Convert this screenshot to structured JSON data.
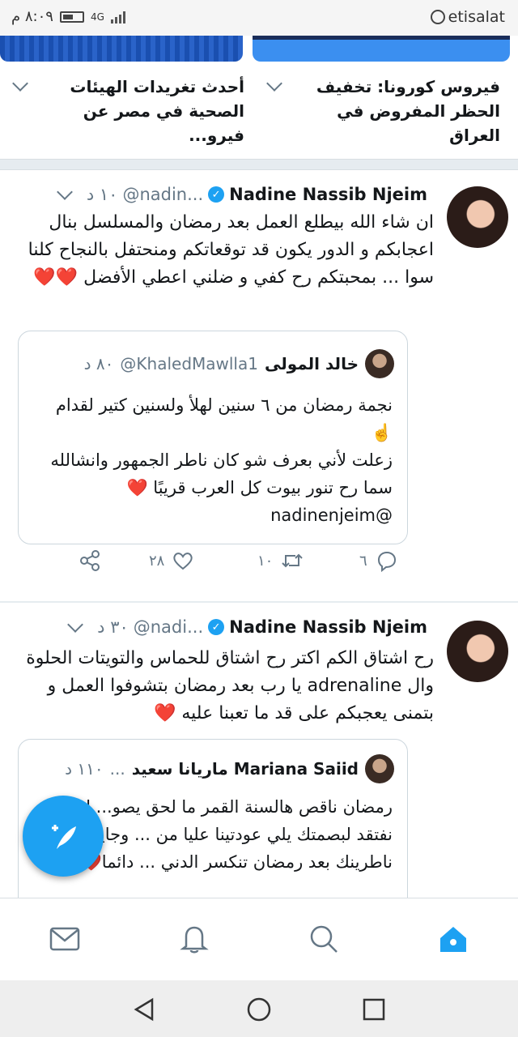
{
  "status_bar": {
    "carrier": "etisalat",
    "time": "٨:٠٩ م",
    "network": "4G"
  },
  "trends": [
    {
      "text": "فيروس كورونا: تخفيف الحظر المفروض في العراق"
    },
    {
      "text": "أحدث تغريدات الهيئات الصحية في مصر عن فيرو..."
    }
  ],
  "tweets": [
    {
      "name": "Nadine Nassib Njeim",
      "handle": "@nadin...",
      "time": "١٠ د",
      "text": "ان شاء الله بيطلع العمل بعد رمضان والمسلسل بنال اعجابكم و الدور يكون قد توقعاتكم ومنحتفل بالنجاح كلنا سوا ... بمحبتكم رح كفي و ضلني اعطي الأفضل ❤️❤️",
      "quote": {
        "name": "خالد المولى",
        "handle": "@KhaledMawlla1",
        "time": "٨٠ د",
        "text": "نجمة رمضان من ٦ سنين لهلأ ولسنين كتير لقدام ☝️\nزعلت لأني بعرف شو كان ناطر الجمهور وانشالله سما رح تنور بيوت كل العرب قريبًا ❤️\n@nadinenjeim"
      },
      "replies": "٦",
      "retweets": "١٠",
      "likes": "٢٨"
    },
    {
      "name": "Nadine Nassib Njeim",
      "handle": "@nadi...",
      "time": "٣٠ د",
      "text": "رح اشتاق الكم اكتر رح اشتاق للحماس والتويتات الحلوة وال adrenaline يا رب بعد رمضان بتشوفوا العمل و بتمنى يعجبكم على قد ما تعبنا عليه ❤️",
      "quote": {
        "name": "Mariana Saiid ماريانا سعيد",
        "handle": "...",
        "time": "١١٠ د",
        "text": "رمضان ناقص هالسنة القمر ما لحق يصو... لح نفتقد لبصمتك يلي عودتينا عليا من ... وجاية. ناطرينك بعد رمضان تنكسر الدني ... دائما❤️"
      }
    }
  ],
  "colors": {
    "accent": "#1da1f2",
    "heart": "#e0245e",
    "muted": "#657786"
  }
}
